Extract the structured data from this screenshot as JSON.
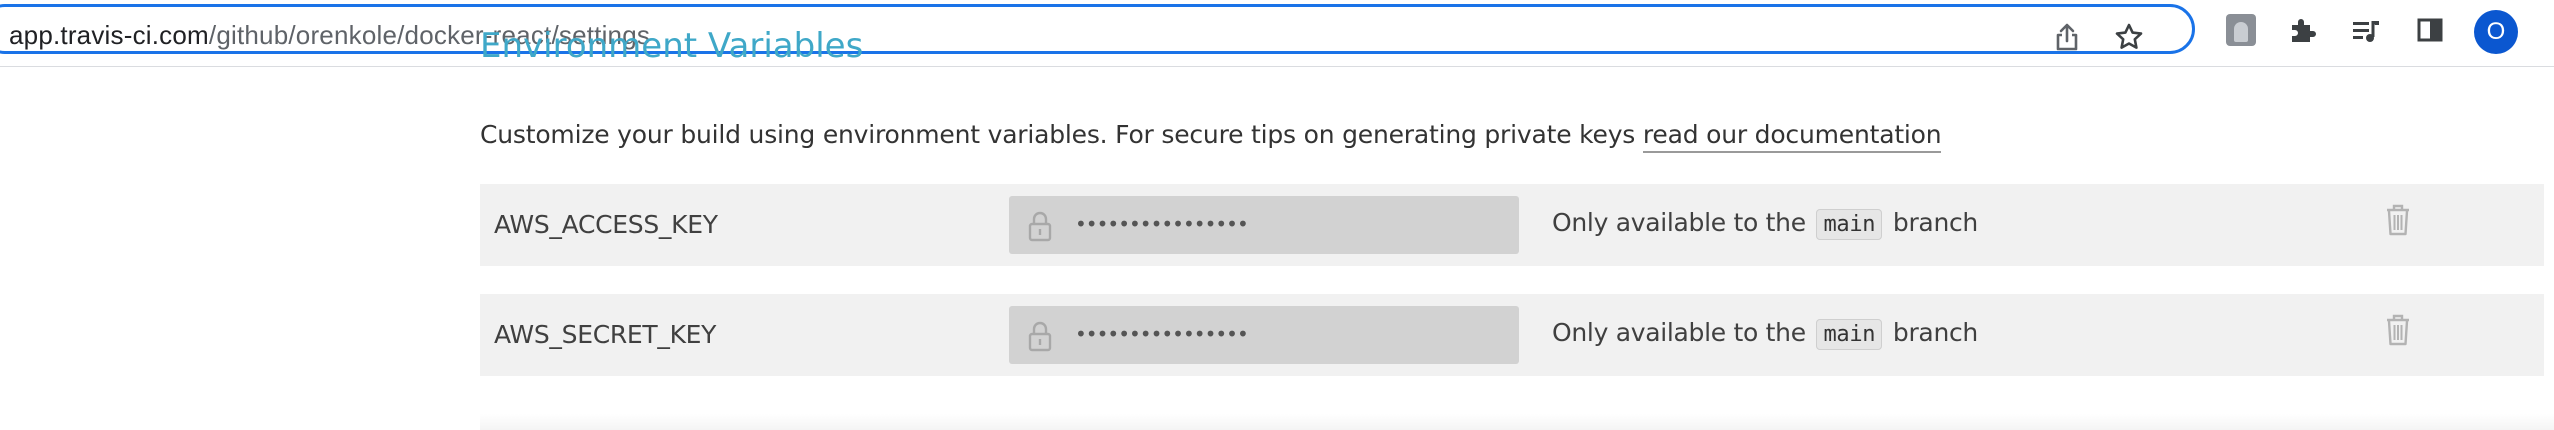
{
  "browser": {
    "url_host": "app.travis-ci.com",
    "url_path": "/github/orenkole/docker-react/settings",
    "profile_initial": "O",
    "accent_color": "#1a73e8",
    "icons": [
      "share-icon",
      "bookmark-star-icon",
      "extension-avatar-icon",
      "extensions-puzzle-icon",
      "media-queue-icon",
      "side-panel-icon"
    ]
  },
  "settings": {
    "section_title": "Environment Variables",
    "intro_text": "Customize your build using environment variables. For secure tips on generating private keys ",
    "intro_link": "read our documentation",
    "env_vars": [
      {
        "name": "AWS_ACCESS_KEY",
        "masked_value": "••••••••••••••••",
        "branch_prefix": "Only available to the",
        "branch": "main",
        "branch_suffix": "branch"
      },
      {
        "name": "AWS_SECRET_KEY",
        "masked_value": "••••••••••••••••",
        "branch_prefix": "Only available to the",
        "branch": "main",
        "branch_suffix": "branch"
      }
    ],
    "heading_color": "#3fa8c8"
  }
}
